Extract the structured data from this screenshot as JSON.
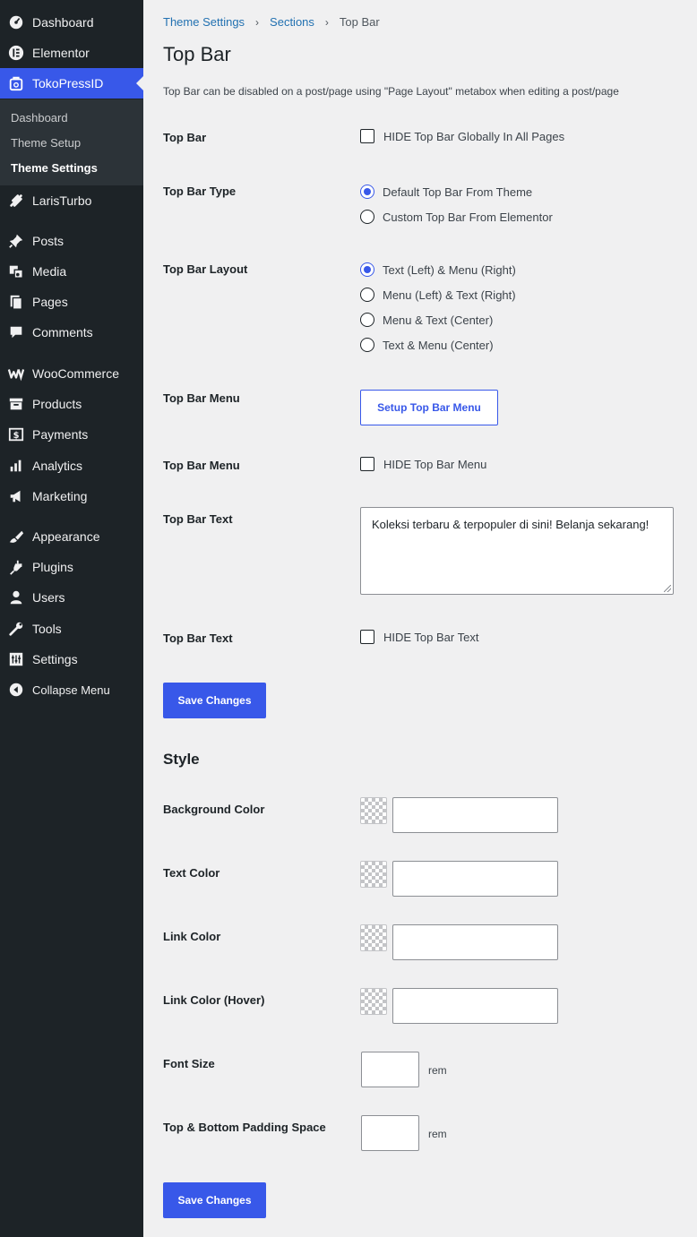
{
  "sidebar": {
    "items": [
      {
        "label": "Dashboard",
        "icon": "dashboard-icon"
      },
      {
        "label": "Elementor",
        "icon": "elementor-icon"
      },
      {
        "label": "TokoPressID",
        "icon": "tokopress-icon"
      },
      {
        "label": "LarisTurbo",
        "icon": "laristurbo-icon"
      },
      {
        "label": "Posts",
        "icon": "pin-icon"
      },
      {
        "label": "Media",
        "icon": "media-icon"
      },
      {
        "label": "Pages",
        "icon": "pages-icon"
      },
      {
        "label": "Comments",
        "icon": "comment-icon"
      },
      {
        "label": "WooCommerce",
        "icon": "woocommerce-icon"
      },
      {
        "label": "Products",
        "icon": "archive-icon"
      },
      {
        "label": "Payments",
        "icon": "dollar-icon"
      },
      {
        "label": "Analytics",
        "icon": "bar-chart-icon"
      },
      {
        "label": "Marketing",
        "icon": "megaphone-icon"
      },
      {
        "label": "Appearance",
        "icon": "brush-icon"
      },
      {
        "label": "Plugins",
        "icon": "plug-icon"
      },
      {
        "label": "Users",
        "icon": "user-icon"
      },
      {
        "label": "Tools",
        "icon": "wrench-icon"
      },
      {
        "label": "Settings",
        "icon": "settings-icon"
      },
      {
        "label": "Collapse Menu",
        "icon": "collapse-icon"
      }
    ],
    "submenu": [
      "Dashboard",
      "Theme Setup",
      "Theme Settings"
    ],
    "accent_color": "#3858e9"
  },
  "breadcrumb": {
    "items": [
      "Theme Settings",
      "Sections",
      "Top Bar"
    ]
  },
  "page": {
    "title": "Top Bar",
    "description": "Top Bar can be disabled on a post/page using \"Page Layout\" metabox when editing a post/page"
  },
  "fields": {
    "top_bar": {
      "label": "Top Bar",
      "checkbox": "HIDE Top Bar Globally In All Pages"
    },
    "top_bar_type": {
      "label": "Top Bar Type",
      "options": [
        "Default Top Bar From Theme",
        "Custom Top Bar From Elementor"
      ],
      "selected": 0
    },
    "top_bar_layout": {
      "label": "Top Bar Layout",
      "options": [
        "Text (Left) & Menu (Right)",
        "Menu (Left) & Text (Right)",
        "Menu & Text (Center)",
        "Text & Menu (Center)"
      ],
      "selected": 0
    },
    "top_bar_menu": {
      "label": "Top Bar Menu",
      "button": "Setup Top Bar Menu"
    },
    "top_bar_menu_hide": {
      "label": "Top Bar Menu",
      "checkbox": "HIDE Top Bar Menu"
    },
    "top_bar_text": {
      "label": "Top Bar Text",
      "value": "Koleksi terbaru & terpopuler di sini! Belanja sekarang!"
    },
    "top_bar_text_hide": {
      "label": "Top Bar Text",
      "checkbox": "HIDE Top Bar Text"
    }
  },
  "save_label": "Save Changes",
  "style": {
    "title": "Style",
    "colors": [
      {
        "label": "Background Color"
      },
      {
        "label": "Text Color"
      },
      {
        "label": "Link Color"
      },
      {
        "label": "Link Color (Hover)"
      }
    ],
    "font_size": {
      "label": "Font Size",
      "unit": "rem"
    },
    "padding": {
      "label": "Top & Bottom Padding Space",
      "unit": "rem"
    }
  }
}
